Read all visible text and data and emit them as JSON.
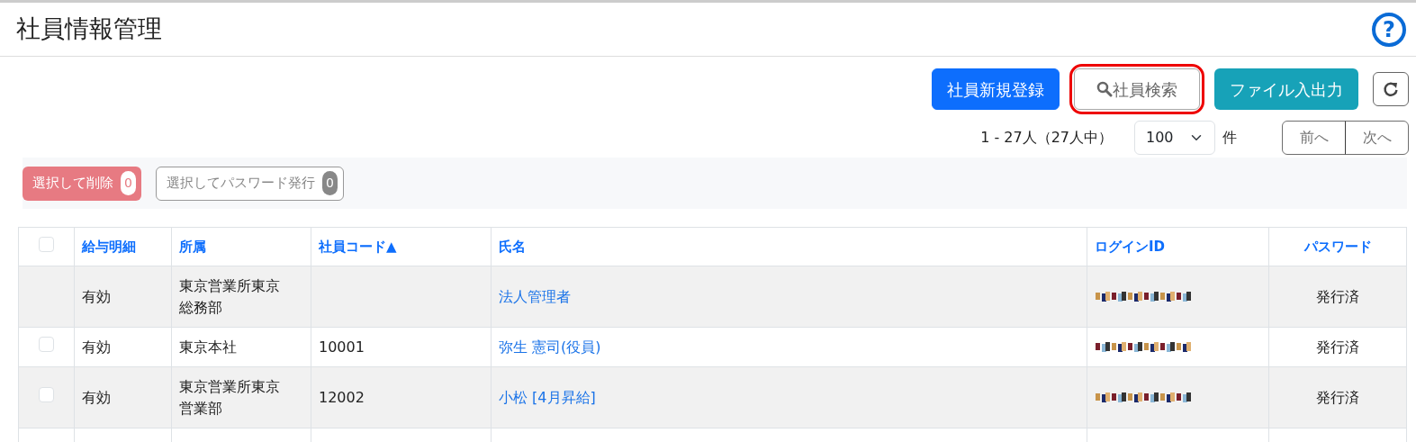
{
  "page": {
    "title": "社員情報管理",
    "help_icon": "?"
  },
  "toolbar": [
    {
      "label": "社員新規登録",
      "kind": "primary"
    },
    {
      "label": "社員検索",
      "kind": "search",
      "annotated": true
    },
    {
      "label": "ファイル入出力",
      "kind": "info"
    },
    {
      "kind": "refresh"
    }
  ],
  "pager": {
    "summary": "1 - 27人（27人中）",
    "page_size": "100",
    "unit": "件",
    "prev": "前へ",
    "next": "次へ",
    "prev_disabled": true,
    "next_disabled": true
  },
  "bulk_actions": [
    {
      "label": "選択して削除",
      "count": "0",
      "kind": "danger"
    },
    {
      "label": "選択してパスワード発行",
      "count": "0",
      "kind": "outline"
    }
  ],
  "table": {
    "select_all_checked": false,
    "columns": [
      "給与明細",
      "所属",
      "社員コード▲",
      "氏名",
      "ログインID",
      "パスワード"
    ],
    "rows": [
      {
        "selectable": false,
        "payslip": "有効",
        "department": "東京営業所東京総務部",
        "code": "",
        "name": "法人管理者",
        "password": "発行済"
      },
      {
        "selectable": true,
        "checked": false,
        "payslip": "有効",
        "department": "東京本社",
        "code": "10001",
        "name": "弥生 憲司(役員)",
        "password": "発行済"
      },
      {
        "selectable": true,
        "checked": false,
        "payslip": "有効",
        "department": "東京営業所東京営業部",
        "code": "12002",
        "name": "小松 [4月昇給]",
        "password": "発行済"
      }
    ]
  }
}
